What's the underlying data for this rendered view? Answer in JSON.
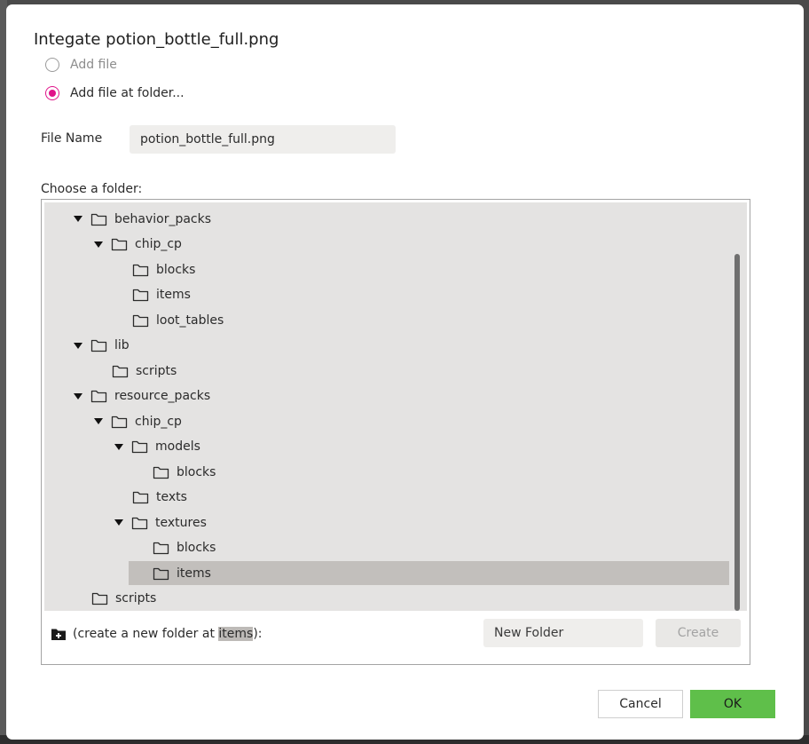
{
  "dialog": {
    "title": "Integate potion_bottle_full.png",
    "options": [
      {
        "label": "Add file",
        "checked": false
      },
      {
        "label": "Add file at folder...",
        "checked": true
      }
    ],
    "file_name_label": "File Name",
    "file_name_value": "potion_bottle_full.png",
    "choose_folder_label": "Choose a folder:",
    "tree": [
      {
        "label": "behavior_packs",
        "depth": 0,
        "expanded": true
      },
      {
        "label": "chip_cp",
        "depth": 1,
        "expanded": true
      },
      {
        "label": "blocks",
        "depth": 2,
        "expanded": null
      },
      {
        "label": "items",
        "depth": 2,
        "expanded": null
      },
      {
        "label": "loot_tables",
        "depth": 2,
        "expanded": null
      },
      {
        "label": "lib",
        "depth": 0,
        "expanded": true
      },
      {
        "label": "scripts",
        "depth": 1,
        "expanded": null
      },
      {
        "label": "resource_packs",
        "depth": 0,
        "expanded": true
      },
      {
        "label": "chip_cp",
        "depth": 1,
        "expanded": true
      },
      {
        "label": "models",
        "depth": 2,
        "expanded": true
      },
      {
        "label": "blocks",
        "depth": 3,
        "expanded": null
      },
      {
        "label": "texts",
        "depth": 2,
        "expanded": null
      },
      {
        "label": "textures",
        "depth": 2,
        "expanded": true
      },
      {
        "label": "blocks",
        "depth": 3,
        "expanded": null
      },
      {
        "label": "items",
        "depth": 3,
        "expanded": null,
        "selected": true
      },
      {
        "label": "scripts",
        "depth": 0,
        "expanded": null
      }
    ],
    "create_prefix": "(create a new folder at ",
    "create_target": "items",
    "create_suffix": "):",
    "new_folder_value": "New Folder",
    "create_button": "Create",
    "cancel_button": "Cancel",
    "ok_button": "OK"
  },
  "colors": {
    "accent_radio": "#e0148a",
    "ok_green": "#5fbf4a",
    "tree_bg": "#e4e3e2",
    "selected_row": "#c2bfbc"
  },
  "icons": [
    "folder-icon",
    "caret-down-icon",
    "add-folder-icon"
  ]
}
